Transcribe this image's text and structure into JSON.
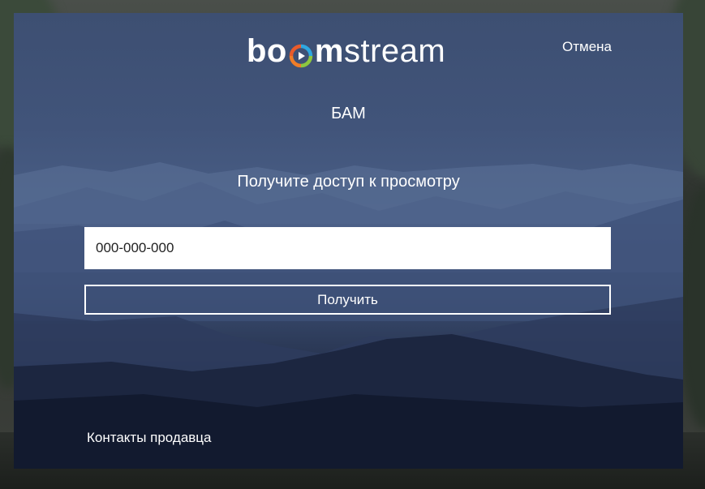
{
  "brand": {
    "logo_prefix": "bo",
    "logo_middle": "m",
    "logo_suffix": "stream"
  },
  "header": {
    "cancel_label": "Отмена"
  },
  "main": {
    "title": "БАМ",
    "subtitle": "Получите доступ к просмотру",
    "code_input": {
      "value": "000-000-000",
      "placeholder": "000-000-000"
    },
    "submit_label": "Получить"
  },
  "footer": {
    "contacts_label": "Контакты продавца"
  },
  "colors": {
    "accent_orange": "#f07d28",
    "accent_blue": "#2ea7e0",
    "accent_green": "#8dc63f",
    "panel": "#3d4f72"
  },
  "icons": {
    "logo_ring": "play-ring-icon"
  }
}
